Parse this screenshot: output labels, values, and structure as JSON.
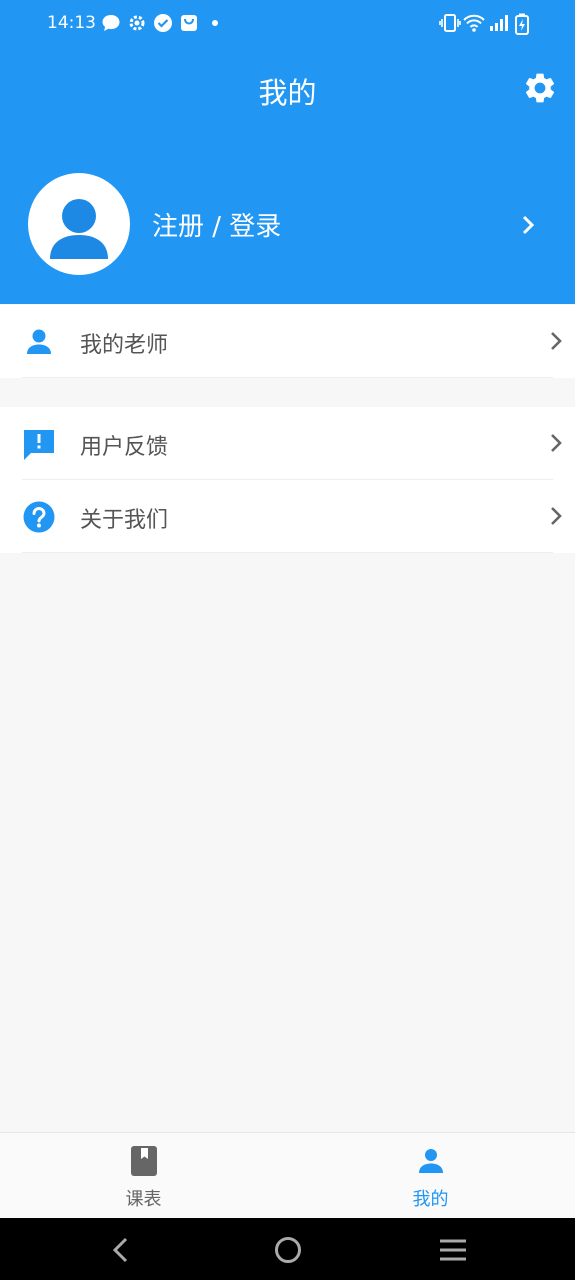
{
  "status_bar": {
    "time": "14:13"
  },
  "header": {
    "title": "我的"
  },
  "profile": {
    "login_label": "注册 / 登录"
  },
  "menu": {
    "group1": [
      {
        "label": "我的老师",
        "icon": "person-icon"
      }
    ],
    "group2": [
      {
        "label": "用户反馈",
        "icon": "feedback-icon"
      },
      {
        "label": "关于我们",
        "icon": "help-icon"
      }
    ]
  },
  "bottom_nav": {
    "tabs": [
      {
        "label": "课表",
        "icon": "book-icon",
        "active": false
      },
      {
        "label": "我的",
        "icon": "person-icon",
        "active": true
      }
    ]
  },
  "colors": {
    "primary": "#2196f3",
    "inactive": "#666666",
    "background": "#f7f7f7"
  }
}
